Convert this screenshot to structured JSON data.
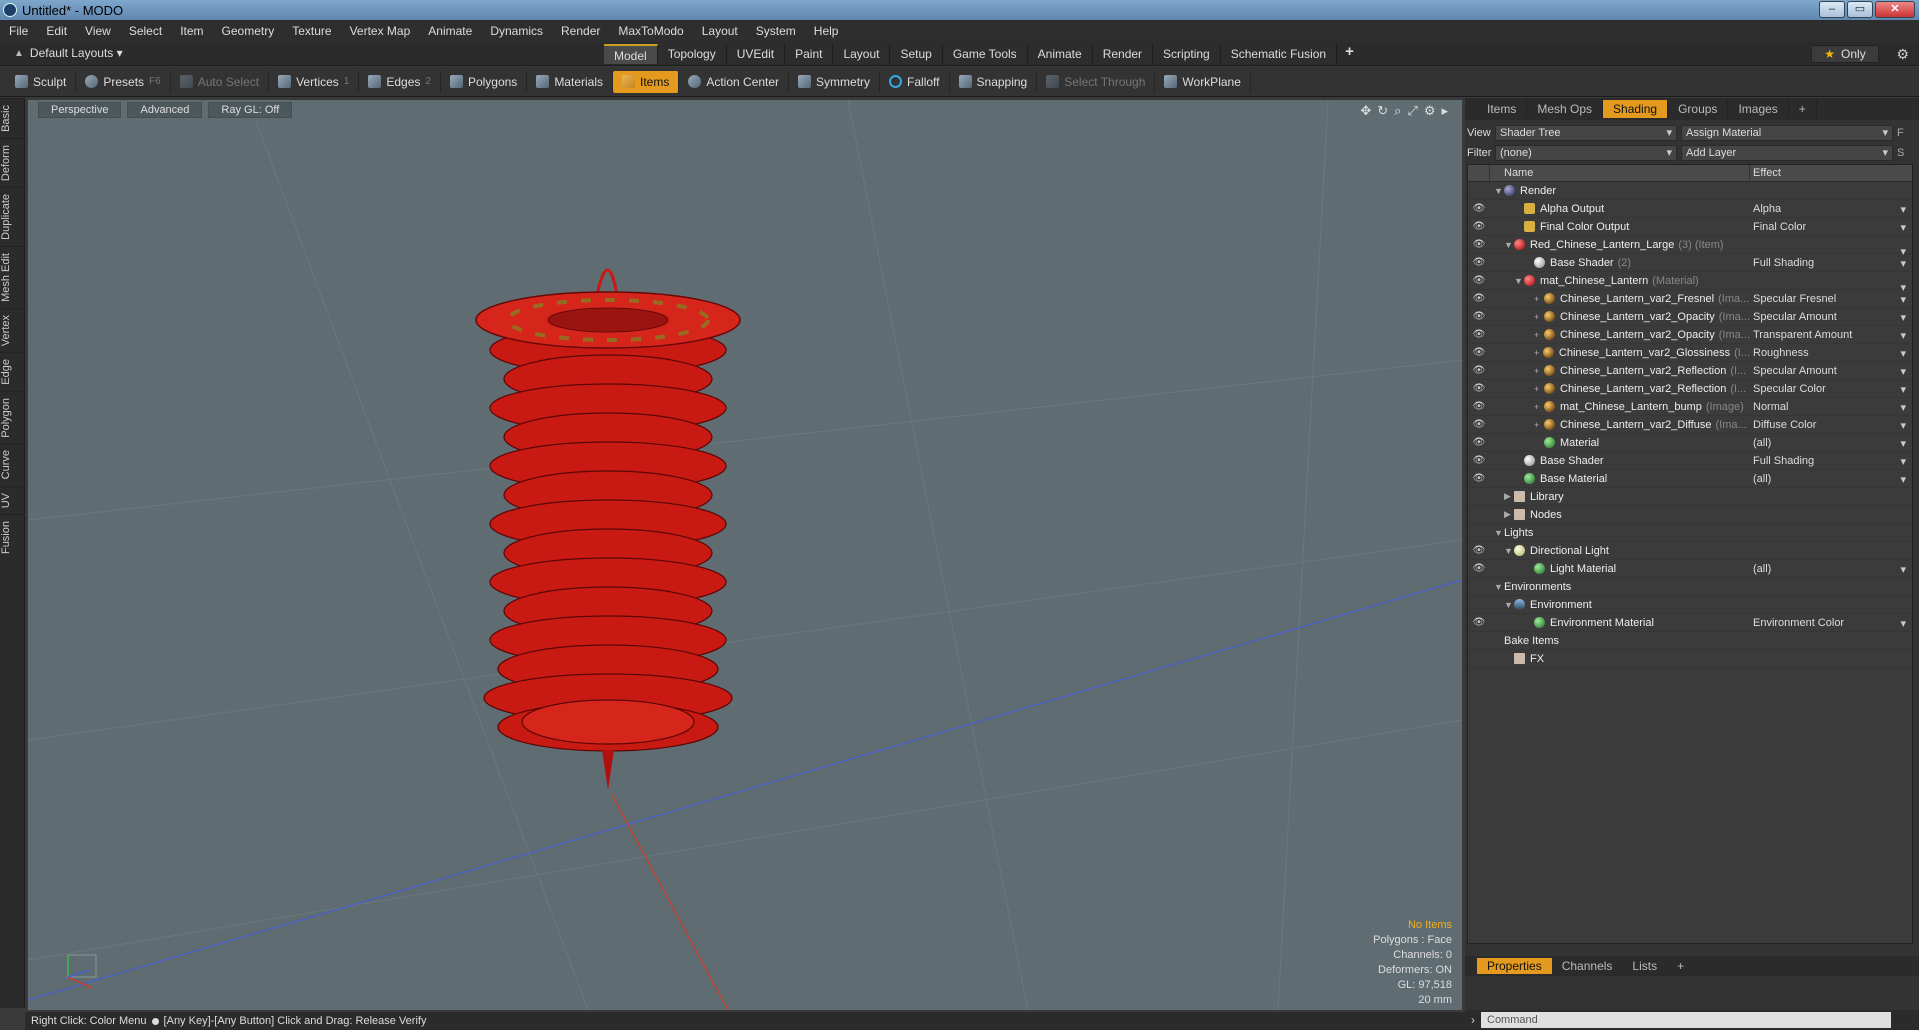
{
  "window": {
    "title": "Untitled* - MODO",
    "min": "–",
    "max": "▭",
    "close": "✕"
  },
  "menu": [
    "File",
    "Edit",
    "View",
    "Select",
    "Item",
    "Geometry",
    "Texture",
    "Vertex Map",
    "Animate",
    "Dynamics",
    "Render",
    "MaxToModo",
    "Layout",
    "System",
    "Help"
  ],
  "layouts": {
    "label": "Default Layouts ▾"
  },
  "mode_tabs": [
    "Model",
    "Topology",
    "UVEdit",
    "Paint",
    "Layout",
    "Setup",
    "Game Tools",
    "Animate",
    "Render",
    "Scripting",
    "Schematic Fusion"
  ],
  "mode_active": "Model",
  "plus": "+",
  "only": "Only",
  "toolbar": {
    "sculpt": "Sculpt",
    "presets": "Presets",
    "presets_key": "F6",
    "auto_select": "Auto Select",
    "vertices": "Vertices",
    "vertices_key": "1",
    "edges": "Edges",
    "edges_key": "2",
    "polygons": "Polygons",
    "materials": "Materials",
    "items": "Items",
    "action_center": "Action Center",
    "symmetry": "Symmetry",
    "falloff": "Falloff",
    "snapping": "Snapping",
    "select_through": "Select Through",
    "workplane": "WorkPlane"
  },
  "left_tabs": [
    "Basic",
    "Deform",
    "Duplicate",
    "Mesh Edit",
    "Vertex",
    "Edge",
    "Polygon",
    "Curve",
    "UV",
    "Fusion"
  ],
  "viewport": {
    "perspective": "Perspective",
    "advanced": "Advanced",
    "raygl": "Ray GL: Off",
    "info": {
      "no_items": "No Items",
      "polygons": "Polygons : Face",
      "channels": "Channels: 0",
      "deformers": "Deformers: ON",
      "gl": "GL: 97,518",
      "scale": "20 mm"
    }
  },
  "status": {
    "left": "Right Click: Color Menu",
    "right": "[Any Key]-[Any Button] Click and Drag: Release Verify"
  },
  "right_tabs": [
    "Items",
    "Mesh Ops",
    "Shading",
    "Groups",
    "Images"
  ],
  "right_active": "Shading",
  "shading": {
    "view_label": "View",
    "view_value": "Shader Tree",
    "assign": "Assign Material",
    "assign_key": "F",
    "filter_label": "Filter",
    "filter_value": "(none)",
    "add_layer": "Add Layer",
    "add_key": "S",
    "col_name": "Name",
    "col_effect": "Effect"
  },
  "tree": [
    {
      "indent": 0,
      "tw": "▼",
      "icon": "render",
      "name": "Render",
      "sub": "",
      "effect": "",
      "eye": false,
      "dd": false
    },
    {
      "indent": 2,
      "tw": "",
      "icon": "out",
      "name": "Alpha Output",
      "sub": "",
      "effect": "Alpha",
      "eye": true,
      "dd": true
    },
    {
      "indent": 2,
      "tw": "",
      "icon": "out",
      "name": "Final Color Output",
      "sub": "",
      "effect": "Final Color",
      "eye": true,
      "dd": true
    },
    {
      "indent": 1,
      "tw": "▼",
      "icon": "red",
      "name": "Red_Chinese_Lantern_Large",
      "sub": "(3) (Item)",
      "effect": "",
      "eye": true,
      "dd": true
    },
    {
      "indent": 3,
      "tw": "",
      "icon": "white",
      "name": "Base Shader",
      "sub": "(2)",
      "effect": "Full Shading",
      "eye": true,
      "dd": true
    },
    {
      "indent": 2,
      "tw": "▼",
      "icon": "red",
      "name": "mat_Chinese_Lantern",
      "sub": "(Material)",
      "effect": "",
      "eye": true,
      "dd": true
    },
    {
      "indent": 4,
      "tw": "+",
      "icon": "img",
      "name": "Chinese_Lantern_var2_Fresnel",
      "sub": "(Ima...",
      "effect": "Specular Fresnel",
      "eye": true,
      "dd": true
    },
    {
      "indent": 4,
      "tw": "+",
      "icon": "img",
      "name": "Chinese_Lantern_var2_Opacity",
      "sub": "(Ima...",
      "effect": "Specular Amount",
      "eye": true,
      "dd": true
    },
    {
      "indent": 4,
      "tw": "+",
      "icon": "img",
      "name": "Chinese_Lantern_var2_Opacity",
      "sub": "(Ima...",
      "effect": "Transparent Amount",
      "eye": true,
      "dd": true
    },
    {
      "indent": 4,
      "tw": "+",
      "icon": "img",
      "name": "Chinese_Lantern_var2_Glossiness",
      "sub": "(I...",
      "effect": "Roughness",
      "eye": true,
      "dd": true
    },
    {
      "indent": 4,
      "tw": "+",
      "icon": "img",
      "name": "Chinese_Lantern_var2_Reflection",
      "sub": "(I...",
      "effect": "Specular Amount",
      "eye": true,
      "dd": true
    },
    {
      "indent": 4,
      "tw": "+",
      "icon": "img",
      "name": "Chinese_Lantern_var2_Reflection",
      "sub": "(I...",
      "effect": "Specular Color",
      "eye": true,
      "dd": true
    },
    {
      "indent": 4,
      "tw": "+",
      "icon": "img",
      "name": "mat_Chinese_Lantern_bump",
      "sub": "(Image)",
      "effect": "Normal",
      "eye": true,
      "dd": true
    },
    {
      "indent": 4,
      "tw": "+",
      "icon": "img",
      "name": "Chinese_Lantern_var2_Diffuse",
      "sub": "(Ima...",
      "effect": "Diffuse Color",
      "eye": true,
      "dd": true
    },
    {
      "indent": 4,
      "tw": "",
      "icon": "green",
      "name": "Material",
      "sub": "",
      "effect": "(all)",
      "eye": true,
      "dd": true
    },
    {
      "indent": 2,
      "tw": "",
      "icon": "white",
      "name": "Base Shader",
      "sub": "",
      "effect": "Full Shading",
      "eye": true,
      "dd": true
    },
    {
      "indent": 2,
      "tw": "",
      "icon": "green",
      "name": "Base Material",
      "sub": "",
      "effect": "(all)",
      "eye": true,
      "dd": true
    },
    {
      "indent": 1,
      "tw": "▶",
      "icon": "folder",
      "name": "Library",
      "sub": "",
      "effect": "",
      "eye": false,
      "dd": false
    },
    {
      "indent": 1,
      "tw": "▶",
      "icon": "folder",
      "name": "Nodes",
      "sub": "",
      "effect": "",
      "eye": false,
      "dd": false
    },
    {
      "indent": 0,
      "tw": "▼",
      "icon": "",
      "name": "Lights",
      "sub": "",
      "effect": "",
      "eye": false,
      "dd": false
    },
    {
      "indent": 1,
      "tw": "▼",
      "icon": "light",
      "name": "Directional Light",
      "sub": "",
      "effect": "",
      "eye": true,
      "dd": false
    },
    {
      "indent": 3,
      "tw": "",
      "icon": "green",
      "name": "Light Material",
      "sub": "",
      "effect": "(all)",
      "eye": true,
      "dd": true
    },
    {
      "indent": 0,
      "tw": "▼",
      "icon": "",
      "name": "Environments",
      "sub": "",
      "effect": "",
      "eye": false,
      "dd": false
    },
    {
      "indent": 1,
      "tw": "▼",
      "icon": "env",
      "name": "Environment",
      "sub": "",
      "effect": "",
      "eye": false,
      "dd": false
    },
    {
      "indent": 3,
      "tw": "",
      "icon": "green",
      "name": "Environment Material",
      "sub": "",
      "effect": "Environment Color",
      "eye": true,
      "dd": true
    },
    {
      "indent": 0,
      "tw": "",
      "icon": "",
      "name": "Bake Items",
      "sub": "",
      "effect": "",
      "eye": false,
      "dd": false
    },
    {
      "indent": 1,
      "tw": "",
      "icon": "folder",
      "name": "FX",
      "sub": "",
      "effect": "",
      "eye": false,
      "dd": false
    }
  ],
  "prop_tabs": [
    "Properties",
    "Channels",
    "Lists"
  ],
  "prop_active": "Properties",
  "command": {
    "placeholder": "Command"
  },
  "colors": {
    "accent": "#e39a1e",
    "lantern": "#c81a12"
  }
}
